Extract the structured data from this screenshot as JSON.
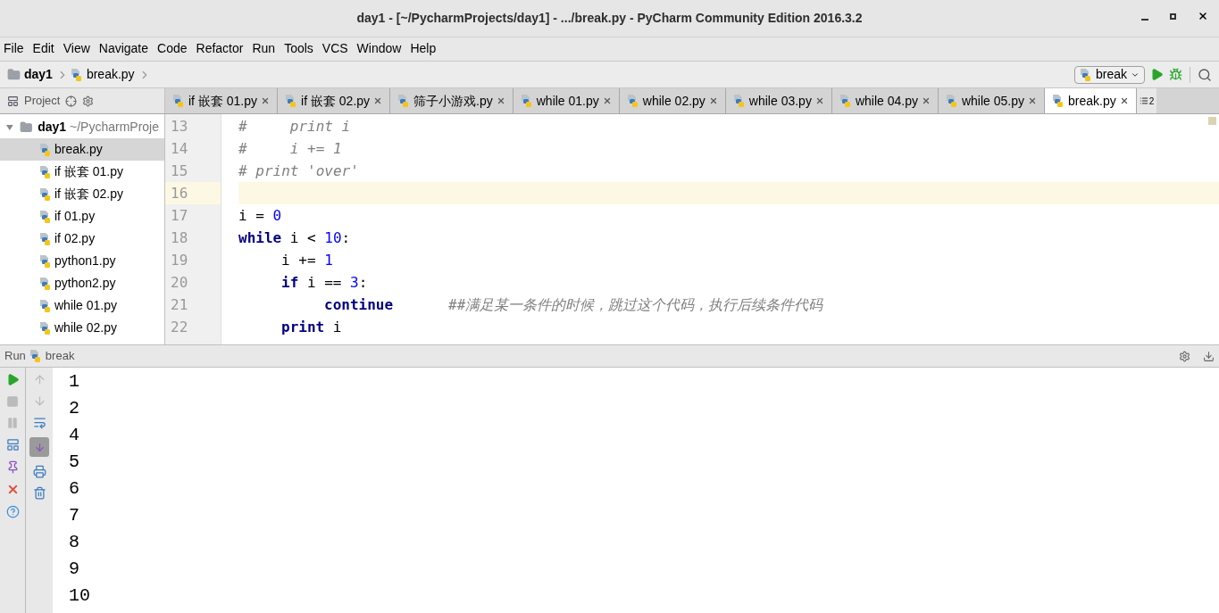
{
  "window": {
    "title": "day1 - [~/PycharmProjects/day1] - .../break.py - PyCharm Community Edition 2016.3.2"
  },
  "menu": [
    "File",
    "Edit",
    "View",
    "Navigate",
    "Code",
    "Refactor",
    "Run",
    "Tools",
    "VCS",
    "Window",
    "Help"
  ],
  "breadcrumbs": [
    {
      "label": "day1",
      "kind": "folder"
    },
    {
      "label": "break.py",
      "kind": "file"
    }
  ],
  "run_config": {
    "label": "break"
  },
  "project_toolbar": {
    "label": "Project"
  },
  "tabs": [
    {
      "label": "if 嵌套 01.py",
      "selected": false
    },
    {
      "label": "if 嵌套 02.py",
      "selected": false
    },
    {
      "label": "筛子小游戏.py",
      "selected": false
    },
    {
      "label": "while 01.py",
      "selected": false
    },
    {
      "label": "while 02.py",
      "selected": false
    },
    {
      "label": "while 03.py",
      "selected": false
    },
    {
      "label": "while 04.py",
      "selected": false
    },
    {
      "label": "while 05.py",
      "selected": false
    },
    {
      "label": "break.py",
      "selected": true
    }
  ],
  "tabs_overflow": "2",
  "project_tree": {
    "label": "day1",
    "path": "~/PycharmProje",
    "expanded": true,
    "children": [
      {
        "label": "break.py",
        "selected": true
      },
      {
        "label": "if 嵌套 01.py",
        "selected": false
      },
      {
        "label": "if 嵌套 02.py",
        "selected": false
      },
      {
        "label": "if 01.py",
        "selected": false
      },
      {
        "label": "if 02.py",
        "selected": false
      },
      {
        "label": "python1.py",
        "selected": false
      },
      {
        "label": "python2.py",
        "selected": false
      },
      {
        "label": "while 01.py",
        "selected": false
      },
      {
        "label": "while 02.py",
        "selected": false
      }
    ]
  },
  "editor": {
    "lines": [
      {
        "number": "13",
        "current": false,
        "tokens": [
          {
            "kind": "comment",
            "text": "#     print i"
          }
        ]
      },
      {
        "number": "14",
        "current": false,
        "tokens": [
          {
            "kind": "comment",
            "text": "#     i += 1"
          }
        ]
      },
      {
        "number": "15",
        "current": false,
        "tokens": [
          {
            "kind": "comment",
            "text": "# print 'over'"
          }
        ]
      },
      {
        "number": "16",
        "current": true
      },
      {
        "number": "17",
        "current": false,
        "tokens": [
          {
            "kind": "plain",
            "text": "i = "
          },
          {
            "kind": "number",
            "text": "0"
          }
        ]
      },
      {
        "number": "18",
        "current": false,
        "tokens": [
          {
            "kind": "keyword",
            "text": "while"
          },
          {
            "kind": "plain",
            "text": " i < "
          },
          {
            "kind": "number",
            "text": "10"
          },
          {
            "kind": "plain",
            "text": ":"
          }
        ],
        "children": [
          {
            "number": "19",
            "current": false,
            "tokens": [
              {
                "kind": "plain",
                "text": "i += "
              },
              {
                "kind": "number",
                "text": "1"
              }
            ]
          },
          {
            "number": "20",
            "current": false,
            "tokens": [
              {
                "kind": "keyword",
                "text": "if"
              },
              {
                "kind": "plain",
                "text": " i == "
              },
              {
                "kind": "number",
                "text": "3"
              },
              {
                "kind": "plain",
                "text": ":"
              }
            ],
            "children": [
              {
                "number": "21",
                "current": false,
                "tokens": [
                  {
                    "kind": "keyword",
                    "text": "continue"
                  },
                  {
                    "kind": "comment",
                    "text": "##满足某一条件的时候，跳过这个代码，执行后续条件代码"
                  }
                ]
              }
            ]
          },
          {
            "number": "22",
            "current": false,
            "tokens": [
              {
                "kind": "keyword",
                "text": "print"
              },
              {
                "kind": "plain",
                "text": " i"
              }
            ]
          }
        ]
      }
    ]
  },
  "run_panel": {
    "label": "Run",
    "config": "break",
    "output": [
      "1",
      "2",
      "4",
      "5",
      "6",
      "7",
      "8",
      "9",
      "10"
    ]
  }
}
